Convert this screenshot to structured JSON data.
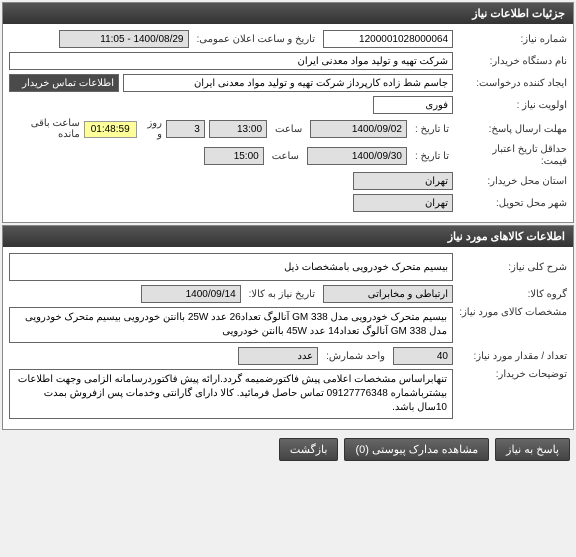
{
  "panel1": {
    "title": "جزئیات اطلاعات نیاز",
    "need_number_label": "شماره نیاز:",
    "need_number": "1200001028000064",
    "announce_date_label": "تاریخ و ساعت اعلان عمومی:",
    "announce_date": "1400/08/29 - 11:05",
    "buyer_label": "نام دستگاه خریدار:",
    "buyer": "شرکت تهیه و تولید مواد معدنی ایران",
    "requester_label": "ایجاد کننده درخواست:",
    "requester": "جاسم شط زاده کارپرداز شرکت تهیه و تولید مواد معدنی ایران",
    "contact_link": "اطلاعات تماس خریدار",
    "priority_label": "اولویت نیاز :",
    "priority": "فوری",
    "deadline_label": "مهلت ارسال پاسخ:",
    "to_date_label": "تا تاریخ :",
    "deadline_date": "1400/09/02",
    "saat_label": "ساعت",
    "deadline_time": "13:00",
    "days_remain": "3",
    "days_txt": "روز و",
    "time_remain": "01:48:59",
    "remain_txt": "ساعت باقی مانده",
    "min_validity_label": "حداقل تاریخ اعتبار",
    "price_label": "قیمت:",
    "validity_date": "1400/09/30",
    "validity_time": "15:00",
    "buyer_province_label": "استان محل خریدار:",
    "buyer_province": "تهران",
    "delivery_city_label": "شهر محل تحویل:",
    "delivery_city": "تهران"
  },
  "panel2": {
    "title": "اطلاعات کالاهای مورد نیاز",
    "desc_label": "شرح کلی نیاز:",
    "desc": "بیسیم متحرک خودرویی بامشخصات ذیل",
    "group_label": "گروه کالا:",
    "group": "ارتباطی و مخابراتی",
    "need_date_label": "تاریخ نیاز به کالا:",
    "need_date": "1400/09/14",
    "spec_label": "مشخصات کالای مورد نیاز:",
    "spec": "بیسیم متحرک خودرویی مدل GM 338 آنالوگ تعداد26 عدد 25W باانتن خودرویی بیسیم متحرک خودرویی مدل GM 338 آنالوگ تعداد14 عدد 45W باانتن خودرویی",
    "qty_label": "تعداد / مقدار مورد نیاز:",
    "qty": "40",
    "unit_label": "واحد شمارش:",
    "unit": "عدد",
    "notes_label": "توضیحات خریدار:",
    "notes": "تنهابراساس مشخصات اعلامی پیش فاکتورضمیمه گردد.ارائه پیش فاکتوردرسامانه الزامی وجهت اطلاعات بیشترباشماره 09127776348 تماس حاصل فرمائید. کالا دارای گارانتی وخدمات پس ازفروش بمدت 10سال باشد."
  },
  "buttons": {
    "reply": "پاسخ به نیاز",
    "attachments": "مشاهده مدارک پیوستی (0)",
    "back": "بازگشت"
  }
}
